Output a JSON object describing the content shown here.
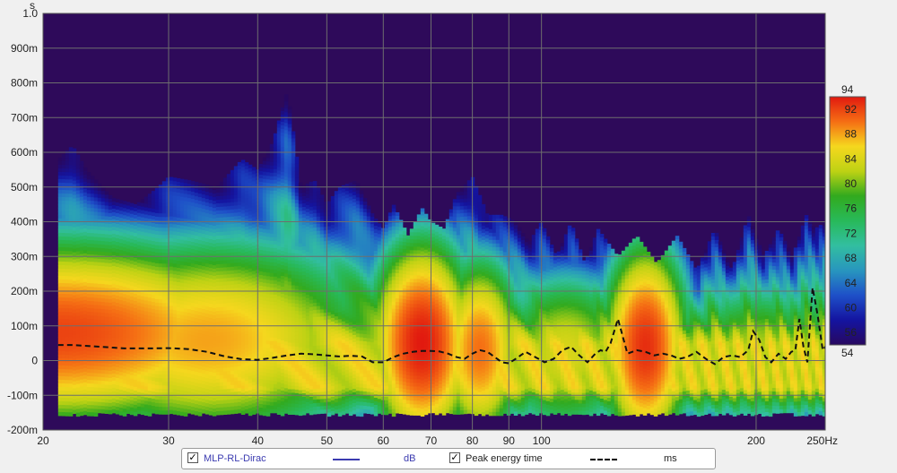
{
  "chart_data": {
    "type": "heatmap",
    "x_scale": "log",
    "xlim": [
      20,
      250
    ],
    "ylim": [
      -0.2,
      1.0
    ],
    "x_ticks": [
      {
        "v": 20,
        "label": "20"
      },
      {
        "v": 30,
        "label": "30"
      },
      {
        "v": 40,
        "label": "40"
      },
      {
        "v": 50,
        "label": "50"
      },
      {
        "v": 60,
        "label": "60"
      },
      {
        "v": 70,
        "label": "70"
      },
      {
        "v": 80,
        "label": "80"
      },
      {
        "v": 90,
        "label": "90"
      },
      {
        "v": 100,
        "label": "100"
      },
      {
        "v": 200,
        "label": "200"
      },
      {
        "v": 250,
        "label": "250Hz"
      }
    ],
    "y_ticks": [
      {
        "v": 1.0,
        "label": "1.0"
      },
      {
        "v": 0.9,
        "label": "900m"
      },
      {
        "v": 0.8,
        "label": "800m"
      },
      {
        "v": 0.7,
        "label": "700m"
      },
      {
        "v": 0.6,
        "label": "600m"
      },
      {
        "v": 0.5,
        "label": "500m"
      },
      {
        "v": 0.4,
        "label": "400m"
      },
      {
        "v": 0.3,
        "label": "300m"
      },
      {
        "v": 0.2,
        "label": "200m"
      },
      {
        "v": 0.1,
        "label": "100m"
      },
      {
        "v": 0.0,
        "label": "0"
      },
      {
        "v": -0.1,
        "label": "-100m"
      },
      {
        "v": -0.2,
        "label": "-200m"
      }
    ],
    "y_unit": "s",
    "colorbar": {
      "min": 54,
      "max": 94,
      "top_label": "94",
      "bottom_label": "54",
      "ticks": [
        "92",
        "88",
        "84",
        "80",
        "76",
        "72",
        "68",
        "64",
        "60",
        "56"
      ],
      "tick_values": [
        92,
        88,
        84,
        80,
        76,
        72,
        68,
        64,
        60,
        56
      ]
    },
    "decay_envelope": {
      "freqs": [
        21,
        22,
        23,
        25,
        27,
        29,
        30,
        32,
        35,
        38,
        40,
        42,
        44,
        46,
        48,
        50,
        52,
        55,
        58,
        60,
        62,
        65,
        68,
        70,
        73,
        76,
        80,
        84,
        88,
        92,
        96,
        100,
        105,
        110,
        115,
        120,
        128,
        136,
        145,
        155,
        165,
        175,
        185,
        195,
        205,
        215,
        225,
        235,
        242,
        250
      ],
      "top_s": [
        0.58,
        0.62,
        0.55,
        0.47,
        0.45,
        0.5,
        0.53,
        0.52,
        0.5,
        0.58,
        0.55,
        0.63,
        0.78,
        0.5,
        0.52,
        0.45,
        0.5,
        0.52,
        0.42,
        0.38,
        0.45,
        0.36,
        0.44,
        0.4,
        0.38,
        0.48,
        0.53,
        0.42,
        0.42,
        0.4,
        0.34,
        0.4,
        0.3,
        0.4,
        0.28,
        0.38,
        0.3,
        0.36,
        0.28,
        0.36,
        0.26,
        0.38,
        0.26,
        0.42,
        0.3,
        0.38,
        0.3,
        0.42,
        0.38,
        0.4
      ],
      "bottom_s": -0.15
    },
    "hot_spots": [
      {
        "freq": 21,
        "spread_oct": 0.8,
        "peak_s": 0.08,
        "width_s": 0.2,
        "level": 92
      },
      {
        "freq": 34,
        "spread_oct": 0.6,
        "peak_s": 0.06,
        "width_s": 0.22,
        "level": 88
      },
      {
        "freq": 68,
        "spread_oct": 0.18,
        "peak_s": 0.05,
        "width_s": 0.22,
        "level": 94
      },
      {
        "freq": 82,
        "spread_oct": 0.15,
        "peak_s": 0.03,
        "width_s": 0.2,
        "level": 90
      },
      {
        "freq": 140,
        "spread_oct": 0.15,
        "peak_s": 0.04,
        "width_s": 0.22,
        "level": 93
      },
      {
        "freq": 108,
        "spread_oct": 0.25,
        "peak_s": 0.02,
        "width_s": 0.18,
        "level": 84
      },
      {
        "freq": 200,
        "spread_oct": 0.3,
        "peak_s": 0.02,
        "width_s": 0.16,
        "level": 82
      }
    ],
    "series": [
      {
        "name": "Peak energy time",
        "unit": "ms",
        "color": "#111111",
        "style": "dashed",
        "x": [
          21,
          22,
          24,
          26,
          28,
          30,
          32,
          34,
          36,
          38,
          40,
          42,
          44,
          46,
          48,
          50,
          52,
          54,
          56,
          58,
          60,
          62,
          64,
          66,
          68,
          70,
          72,
          74,
          76,
          78,
          80,
          82,
          84,
          86,
          88,
          90,
          92,
          95,
          98,
          101,
          104,
          107,
          110,
          113,
          116,
          119,
          121,
          123,
          125,
          128,
          132,
          136,
          140,
          144,
          148,
          152,
          156,
          160,
          165,
          170,
          175,
          180,
          185,
          190,
          195,
          198,
          202,
          206,
          210,
          215,
          220,
          224,
          227,
          230,
          233,
          236,
          240,
          244,
          248,
          250
        ],
        "y": [
          0.045,
          0.045,
          0.04,
          0.035,
          0.035,
          0.036,
          0.033,
          0.025,
          0.012,
          0.004,
          0.002,
          0.008,
          0.015,
          0.02,
          0.018,
          0.015,
          0.012,
          0.014,
          0.012,
          -0.005,
          -0.005,
          0.01,
          0.02,
          0.025,
          0.028,
          0.028,
          0.026,
          0.02,
          0.01,
          0.005,
          0.02,
          0.03,
          0.025,
          0.01,
          -0.005,
          -0.008,
          0.005,
          0.025,
          0.01,
          -0.005,
          0.005,
          0.03,
          0.04,
          0.015,
          -0.005,
          0.02,
          0.03,
          0.025,
          0.05,
          0.12,
          0.02,
          0.03,
          0.025,
          0.015,
          0.02,
          0.015,
          0.005,
          0.01,
          0.025,
          0.005,
          -0.01,
          0.01,
          0.015,
          0.01,
          0.03,
          0.085,
          0.06,
          0.01,
          -0.005,
          0.02,
          0.005,
          0.025,
          0.03,
          0.12,
          0.04,
          -0.005,
          0.21,
          0.13,
          0.03,
          0.04
        ]
      }
    ]
  },
  "legend": {
    "items": [
      {
        "label": "MLP-RL-Dirac",
        "checked": true,
        "unit": "dB",
        "line_color": "#3b3bb0"
      },
      {
        "label": "Peak energy time",
        "checked": true,
        "unit": "ms",
        "line_color": "#000000"
      }
    ]
  },
  "colors": {
    "plot_background": "#2e0a5a",
    "grid": "#6e6e6e",
    "page_background": "#f0f0f0"
  }
}
